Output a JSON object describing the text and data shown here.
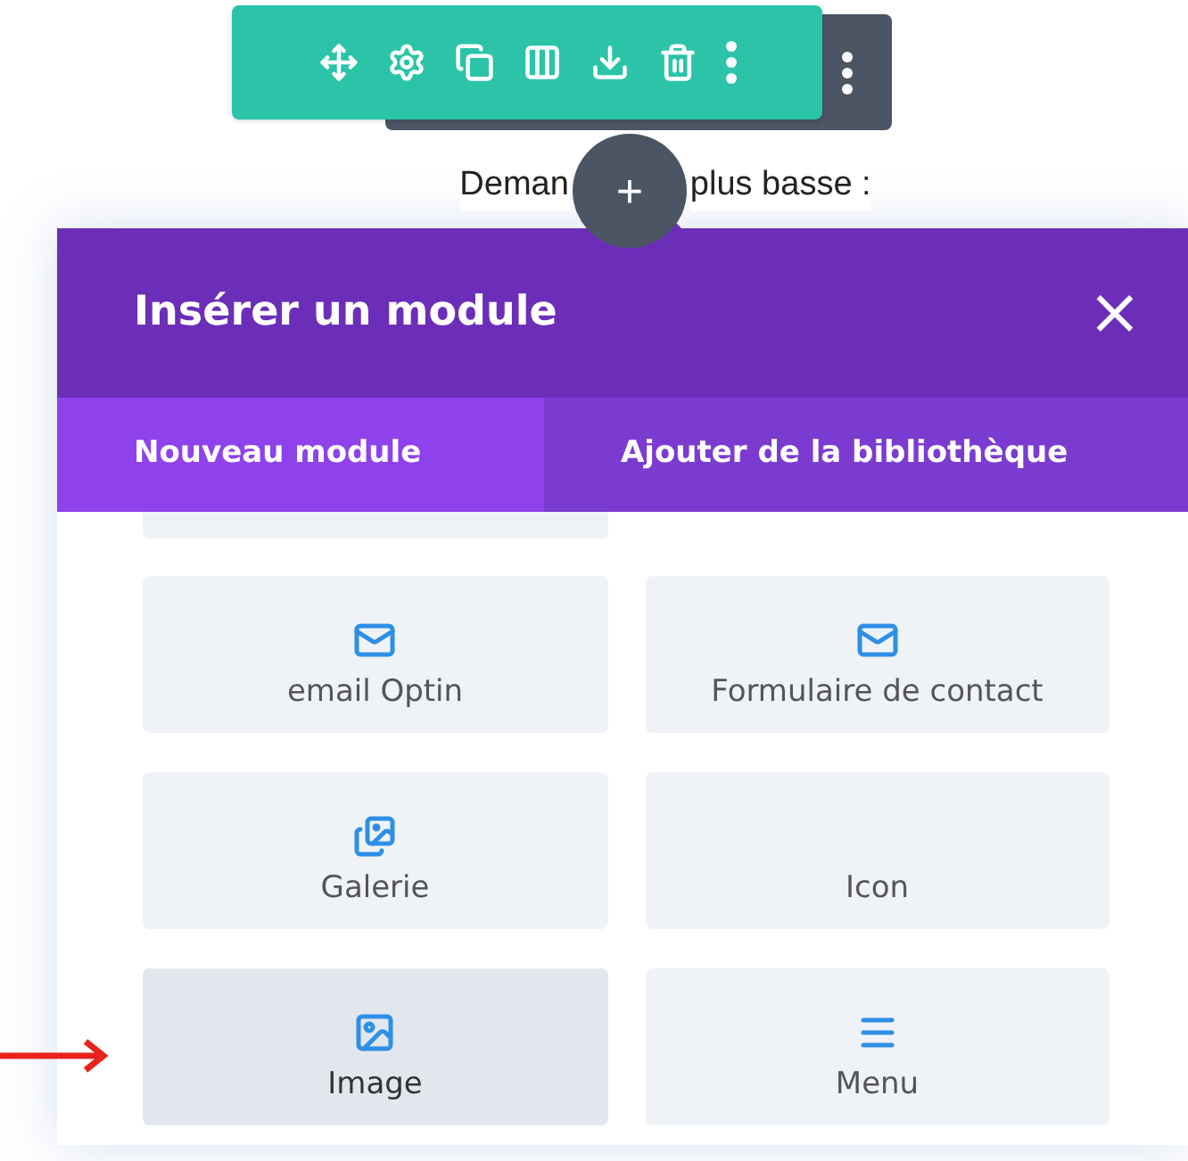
{
  "toolbar": {
    "buttons": [
      {
        "kind": "move"
      },
      {
        "kind": "settings"
      },
      {
        "kind": "duplicate"
      },
      {
        "kind": "columns"
      },
      {
        "kind": "save"
      },
      {
        "kind": "delete"
      },
      {
        "kind": "more"
      }
    ]
  },
  "behind_toolbar": {
    "kind": "more"
  },
  "page_text": {
    "left": "Deman",
    "right": "plus basse :"
  },
  "add_button": {
    "label": "+"
  },
  "modal": {
    "title": "Insérer un module",
    "close": "×",
    "tabs": [
      {
        "label": "Nouveau module",
        "selected": true
      },
      {
        "label": "Ajouter de la bibliothèque",
        "selected": false
      }
    ],
    "modules": [
      {
        "label": "email Optin",
        "kind": "mail",
        "selected": false
      },
      {
        "label": "Formulaire de contact",
        "kind": "mail",
        "selected": false
      },
      {
        "label": "Galerie",
        "kind": "gallery",
        "selected": false
      },
      {
        "label": "Icon",
        "kind": "plain",
        "selected": false
      },
      {
        "label": "Image",
        "kind": "image",
        "selected": true
      },
      {
        "label": "Menu",
        "kind": "menu",
        "selected": false
      }
    ]
  },
  "pointer": {
    "kind": "arrow"
  }
}
